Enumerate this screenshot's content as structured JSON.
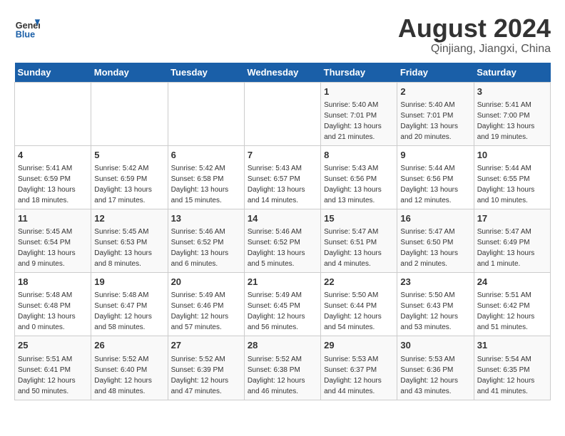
{
  "logo": {
    "line1": "General",
    "line2": "Blue"
  },
  "title": "August 2024",
  "subtitle": "Qinjiang, Jiangxi, China",
  "days_of_week": [
    "Sunday",
    "Monday",
    "Tuesday",
    "Wednesday",
    "Thursday",
    "Friday",
    "Saturday"
  ],
  "weeks": [
    [
      {
        "day": "",
        "sunrise": "",
        "sunset": "",
        "daylight": ""
      },
      {
        "day": "",
        "sunrise": "",
        "sunset": "",
        "daylight": ""
      },
      {
        "day": "",
        "sunrise": "",
        "sunset": "",
        "daylight": ""
      },
      {
        "day": "",
        "sunrise": "",
        "sunset": "",
        "daylight": ""
      },
      {
        "day": "1",
        "sunrise": "Sunrise: 5:40 AM",
        "sunset": "Sunset: 7:01 PM",
        "daylight": "Daylight: 13 hours and 21 minutes."
      },
      {
        "day": "2",
        "sunrise": "Sunrise: 5:40 AM",
        "sunset": "Sunset: 7:01 PM",
        "daylight": "Daylight: 13 hours and 20 minutes."
      },
      {
        "day": "3",
        "sunrise": "Sunrise: 5:41 AM",
        "sunset": "Sunset: 7:00 PM",
        "daylight": "Daylight: 13 hours and 19 minutes."
      }
    ],
    [
      {
        "day": "4",
        "sunrise": "Sunrise: 5:41 AM",
        "sunset": "Sunset: 6:59 PM",
        "daylight": "Daylight: 13 hours and 18 minutes."
      },
      {
        "day": "5",
        "sunrise": "Sunrise: 5:42 AM",
        "sunset": "Sunset: 6:59 PM",
        "daylight": "Daylight: 13 hours and 17 minutes."
      },
      {
        "day": "6",
        "sunrise": "Sunrise: 5:42 AM",
        "sunset": "Sunset: 6:58 PM",
        "daylight": "Daylight: 13 hours and 15 minutes."
      },
      {
        "day": "7",
        "sunrise": "Sunrise: 5:43 AM",
        "sunset": "Sunset: 6:57 PM",
        "daylight": "Daylight: 13 hours and 14 minutes."
      },
      {
        "day": "8",
        "sunrise": "Sunrise: 5:43 AM",
        "sunset": "Sunset: 6:56 PM",
        "daylight": "Daylight: 13 hours and 13 minutes."
      },
      {
        "day": "9",
        "sunrise": "Sunrise: 5:44 AM",
        "sunset": "Sunset: 6:56 PM",
        "daylight": "Daylight: 13 hours and 12 minutes."
      },
      {
        "day": "10",
        "sunrise": "Sunrise: 5:44 AM",
        "sunset": "Sunset: 6:55 PM",
        "daylight": "Daylight: 13 hours and 10 minutes."
      }
    ],
    [
      {
        "day": "11",
        "sunrise": "Sunrise: 5:45 AM",
        "sunset": "Sunset: 6:54 PM",
        "daylight": "Daylight: 13 hours and 9 minutes."
      },
      {
        "day": "12",
        "sunrise": "Sunrise: 5:45 AM",
        "sunset": "Sunset: 6:53 PM",
        "daylight": "Daylight: 13 hours and 8 minutes."
      },
      {
        "day": "13",
        "sunrise": "Sunrise: 5:46 AM",
        "sunset": "Sunset: 6:52 PM",
        "daylight": "Daylight: 13 hours and 6 minutes."
      },
      {
        "day": "14",
        "sunrise": "Sunrise: 5:46 AM",
        "sunset": "Sunset: 6:52 PM",
        "daylight": "Daylight: 13 hours and 5 minutes."
      },
      {
        "day": "15",
        "sunrise": "Sunrise: 5:47 AM",
        "sunset": "Sunset: 6:51 PM",
        "daylight": "Daylight: 13 hours and 4 minutes."
      },
      {
        "day": "16",
        "sunrise": "Sunrise: 5:47 AM",
        "sunset": "Sunset: 6:50 PM",
        "daylight": "Daylight: 13 hours and 2 minutes."
      },
      {
        "day": "17",
        "sunrise": "Sunrise: 5:47 AM",
        "sunset": "Sunset: 6:49 PM",
        "daylight": "Daylight: 13 hours and 1 minute."
      }
    ],
    [
      {
        "day": "18",
        "sunrise": "Sunrise: 5:48 AM",
        "sunset": "Sunset: 6:48 PM",
        "daylight": "Daylight: 13 hours and 0 minutes."
      },
      {
        "day": "19",
        "sunrise": "Sunrise: 5:48 AM",
        "sunset": "Sunset: 6:47 PM",
        "daylight": "Daylight: 12 hours and 58 minutes."
      },
      {
        "day": "20",
        "sunrise": "Sunrise: 5:49 AM",
        "sunset": "Sunset: 6:46 PM",
        "daylight": "Daylight: 12 hours and 57 minutes."
      },
      {
        "day": "21",
        "sunrise": "Sunrise: 5:49 AM",
        "sunset": "Sunset: 6:45 PM",
        "daylight": "Daylight: 12 hours and 56 minutes."
      },
      {
        "day": "22",
        "sunrise": "Sunrise: 5:50 AM",
        "sunset": "Sunset: 6:44 PM",
        "daylight": "Daylight: 12 hours and 54 minutes."
      },
      {
        "day": "23",
        "sunrise": "Sunrise: 5:50 AM",
        "sunset": "Sunset: 6:43 PM",
        "daylight": "Daylight: 12 hours and 53 minutes."
      },
      {
        "day": "24",
        "sunrise": "Sunrise: 5:51 AM",
        "sunset": "Sunset: 6:42 PM",
        "daylight": "Daylight: 12 hours and 51 minutes."
      }
    ],
    [
      {
        "day": "25",
        "sunrise": "Sunrise: 5:51 AM",
        "sunset": "Sunset: 6:41 PM",
        "daylight": "Daylight: 12 hours and 50 minutes."
      },
      {
        "day": "26",
        "sunrise": "Sunrise: 5:52 AM",
        "sunset": "Sunset: 6:40 PM",
        "daylight": "Daylight: 12 hours and 48 minutes."
      },
      {
        "day": "27",
        "sunrise": "Sunrise: 5:52 AM",
        "sunset": "Sunset: 6:39 PM",
        "daylight": "Daylight: 12 hours and 47 minutes."
      },
      {
        "day": "28",
        "sunrise": "Sunrise: 5:52 AM",
        "sunset": "Sunset: 6:38 PM",
        "daylight": "Daylight: 12 hours and 46 minutes."
      },
      {
        "day": "29",
        "sunrise": "Sunrise: 5:53 AM",
        "sunset": "Sunset: 6:37 PM",
        "daylight": "Daylight: 12 hours and 44 minutes."
      },
      {
        "day": "30",
        "sunrise": "Sunrise: 5:53 AM",
        "sunset": "Sunset: 6:36 PM",
        "daylight": "Daylight: 12 hours and 43 minutes."
      },
      {
        "day": "31",
        "sunrise": "Sunrise: 5:54 AM",
        "sunset": "Sunset: 6:35 PM",
        "daylight": "Daylight: 12 hours and 41 minutes."
      }
    ]
  ]
}
